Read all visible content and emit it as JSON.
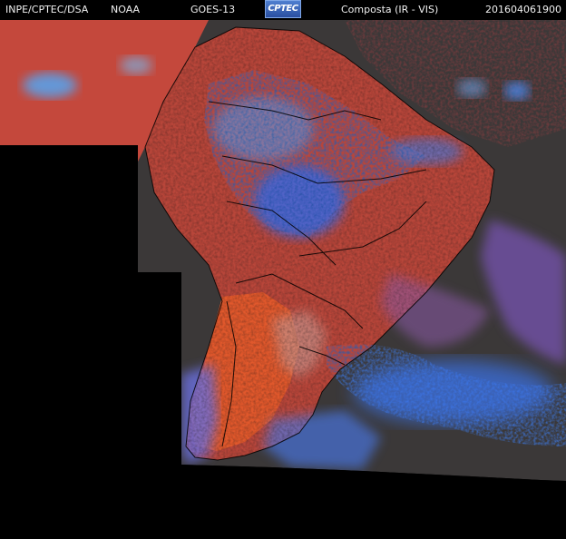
{
  "header": {
    "agency": "INPE/CPTEC/DSA",
    "partner": "NOAA",
    "satellite": "GOES-13",
    "logo_text": "CPTEC",
    "product": "Composta (IR - VIS)",
    "timestamp": "201604061900"
  },
  "colors": {
    "background": "#000000",
    "cloud_high_cold": "#3a6ef0",
    "cloud_mid": "#7a5fb8",
    "warm_surface_red": "#c24a3c",
    "land_orange": "#e05a2a",
    "clear_ocean_gray": "#3a3a3a",
    "border_lines": "#000000"
  }
}
